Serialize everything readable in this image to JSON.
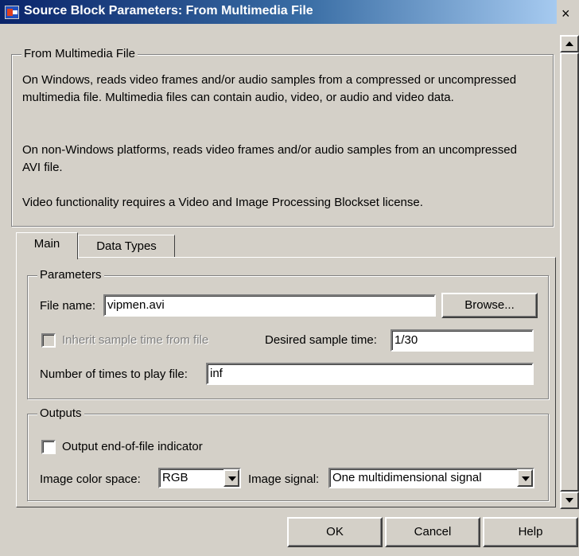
{
  "window": {
    "title": "Source Block Parameters: From Multimedia File",
    "close_glyph": "×"
  },
  "description": {
    "group_label": "From Multimedia File",
    "paragraphs": [
      "On Windows, reads video frames and/or audio samples from a compressed or uncompressed multimedia file. Multimedia files can contain audio, video, or audio and video data.",
      "On non-Windows platforms, reads video frames and/or audio samples from an uncompressed AVI file.",
      "Video functionality requires a Video and Image Processing Blockset license."
    ]
  },
  "tabs": [
    {
      "label": "Main",
      "active": true
    },
    {
      "label": "Data Types",
      "active": false
    }
  ],
  "parameters": {
    "group_label": "Parameters",
    "file_name_label": "File name:",
    "file_name_value": "vipmen.avi",
    "browse_label": "Browse...",
    "inherit_label": "Inherit sample time from file",
    "inherit_checked": false,
    "inherit_enabled": false,
    "desired_sample_time_label": "Desired sample time:",
    "desired_sample_time_value": "1/30",
    "play_count_label": "Number of times to play file:",
    "play_count_value": "inf"
  },
  "outputs": {
    "group_label": "Outputs",
    "eof_label": "Output end-of-file indicator",
    "eof_checked": false,
    "color_space_label": "Image color space:",
    "color_space_value": "RGB",
    "image_signal_label": "Image signal:",
    "image_signal_value": "One multidimensional signal"
  },
  "buttons": {
    "ok": "OK",
    "cancel": "Cancel",
    "help": "Help"
  },
  "icons": {
    "app": "simulink-block-icon",
    "dropdown": "chevron-down-icon"
  },
  "colors": {
    "titlebar_start": "#0a246a",
    "titlebar_end": "#a6caf0",
    "face": "#d4d0c8"
  }
}
